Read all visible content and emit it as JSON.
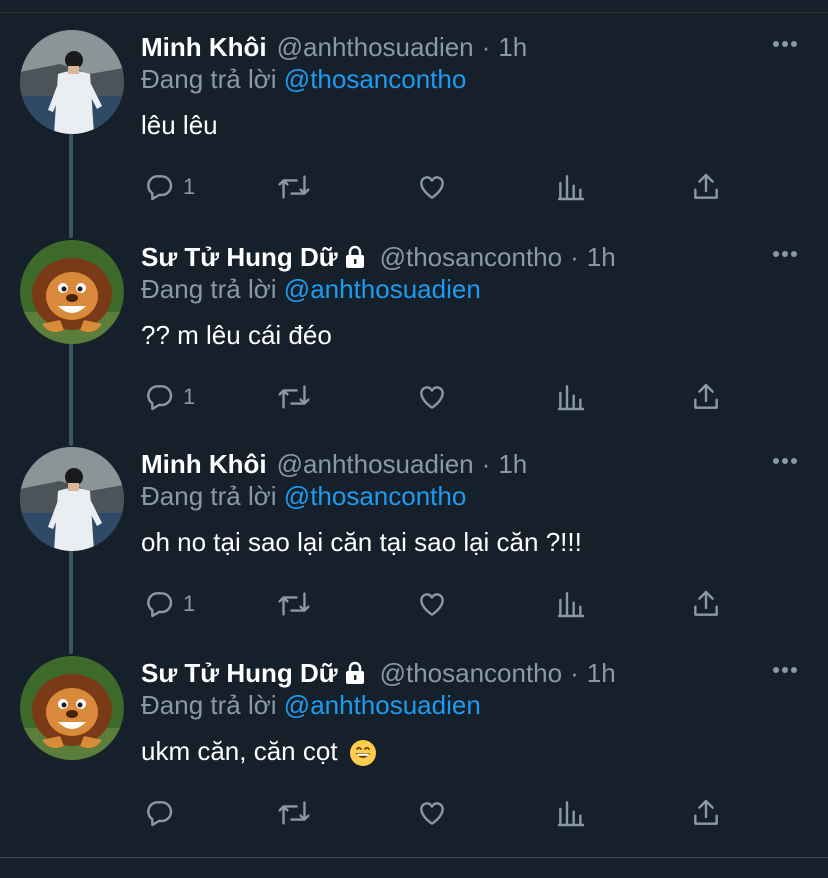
{
  "tweets": [
    {
      "name": "Minh Khôi",
      "handle": "@anhthosuadien",
      "time": "1h",
      "locked": false,
      "reply_prefix": "Đang trả lời",
      "reply_to": "@thosancontho",
      "text": "lêu lêu",
      "reply_count": "1",
      "avatar": "person-photo"
    },
    {
      "name": "Sư Tử Hung Dữ",
      "handle": "@thosancontho",
      "time": "1h",
      "locked": true,
      "reply_prefix": "Đang trả lời",
      "reply_to": "@anhthosuadien",
      "text": "?? m lêu cái đéo",
      "reply_count": "1",
      "avatar": "lion-cartoon"
    },
    {
      "name": "Minh Khôi",
      "handle": "@anhthosuadien",
      "time": "1h",
      "locked": false,
      "reply_prefix": "Đang trả lời",
      "reply_to": "@thosancontho",
      "text": "oh no tại sao lại căn tại sao lại căn ?!!!",
      "reply_count": "1",
      "avatar": "person-photo"
    },
    {
      "name": "Sư Tử Hung Dữ",
      "handle": "@thosancontho",
      "time": "1h",
      "locked": true,
      "reply_prefix": "Đang trả lời",
      "reply_to": "@anhthosuadien",
      "text": "ukm căn, căn cọt",
      "reply_count": "",
      "avatar": "lion-cartoon"
    }
  ],
  "separator": "·",
  "colors": {
    "background": "#15202b",
    "secondary_text": "#8b98a5",
    "accent": "#1d9bf0",
    "thread_line": "#3d5466"
  },
  "icons": [
    "reply-icon",
    "retweet-icon",
    "like-icon",
    "analytics-icon",
    "share-icon",
    "more-icon",
    "lock-icon",
    "grinning-emoji-icon"
  ]
}
